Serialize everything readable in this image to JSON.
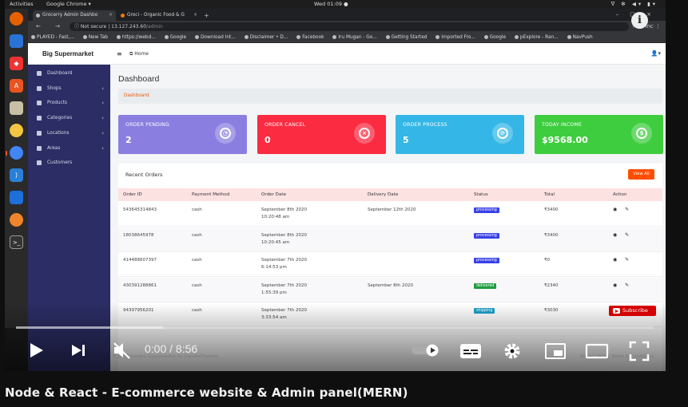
{
  "desktop": {
    "activities": "Activities",
    "app": "Google Chrome ▾",
    "clock": "Wed 01:09 ●",
    "tray": "ᐁ ✻ ◀▾ ▮▾"
  },
  "browser": {
    "tabs": [
      {
        "label": "Grocerry Admin Dashbo",
        "active": true
      },
      {
        "label": "Groci - Organic Food & G",
        "active": false
      }
    ],
    "new_tab": "+",
    "url_prefix": "Not secure | ",
    "url_host": "13.127.243.60",
    "url_path": "/admin",
    "incognito_label": "Inc",
    "bookmarks": [
      "PLAYED - Fast,...",
      "New Tab",
      "https://webd...",
      "Google",
      "Download Int...",
      "Disclaimer • D...",
      "Facebook",
      "Iru Mugan - Go...",
      "Getting Started",
      "Imported Fro...",
      "Google",
      "pExplore - Ran...",
      "NavPush"
    ]
  },
  "admin": {
    "brand": "Big Supermarket",
    "home": "Home",
    "page_title": "Dashboard",
    "breadcrumb": "Dashboard",
    "sidebar": [
      {
        "label": "Dashboard",
        "chevron": ""
      },
      {
        "label": "Shops",
        "chevron": "›"
      },
      {
        "label": "Products",
        "chevron": "›"
      },
      {
        "label": "Categories",
        "chevron": "›"
      },
      {
        "label": "Locations",
        "chevron": "›"
      },
      {
        "label": "Areas",
        "chevron": "›"
      },
      {
        "label": "Customers",
        "chevron": ""
      }
    ],
    "cards": [
      {
        "title": "ORDER PENDING",
        "value": "2",
        "color": "#8a7fe0"
      },
      {
        "title": "ORDER CANCEL",
        "value": "0",
        "color": "#fb2b41"
      },
      {
        "title": "ORDER PROCESS",
        "value": "5",
        "color": "#34b7e6"
      },
      {
        "title": "TODAY INCOME",
        "value": "$9568.00",
        "color": "#3ecd3e"
      }
    ],
    "recent_orders": {
      "heading": "Recent Orders",
      "view_all": "View All",
      "columns": [
        "Order ID",
        "Payment Method",
        "Order Date",
        "Delivery Date",
        "Status",
        "Total",
        "Action"
      ],
      "rows": [
        {
          "id": "543645314843",
          "payment": "cash",
          "date": "September 8th 2020",
          "time": "10:20:48 am",
          "delivery": "September 12th 2020",
          "status": "processing",
          "status_color": "#3840e6",
          "total": "₹3400"
        },
        {
          "id": "18038645978",
          "payment": "cash",
          "date": "September 8th 2020",
          "time": "10:20:45 am",
          "delivery": "",
          "status": "processing",
          "status_color": "#3840e6",
          "total": "₹3400"
        },
        {
          "id": "414488607397",
          "payment": "cash",
          "date": "September 7th 2020",
          "time": "6:14:53 pm",
          "delivery": "",
          "status": "processing",
          "status_color": "#3840e6",
          "total": "₹0"
        },
        {
          "id": "430391288861",
          "payment": "cash",
          "date": "September 7th 2020",
          "time": "1:55:39 pm",
          "delivery": "September 8th 2020",
          "status": "delivered",
          "status_color": "#1e9e3e",
          "total": "₹2340"
        },
        {
          "id": "94397956201",
          "payment": "cash",
          "date": "September 7th 2020",
          "time": "3:33:54 am",
          "delivery": "",
          "status": "shipping",
          "status_color": "#1aa0c8",
          "total": "₹3030"
        }
      ]
    },
    "footer_left": "© 2020 Gambo Supermarket by GambolThemes",
    "footer_right": "Privacy Policy   Terms & Conditions"
  },
  "player": {
    "time": "0:00 / 8:56",
    "progress": 0.0,
    "buffered": 0.23,
    "subscribe": "Subscribe",
    "info": "i",
    "title": "Node & React - E-commerce website & Admin panel(MERN)"
  }
}
